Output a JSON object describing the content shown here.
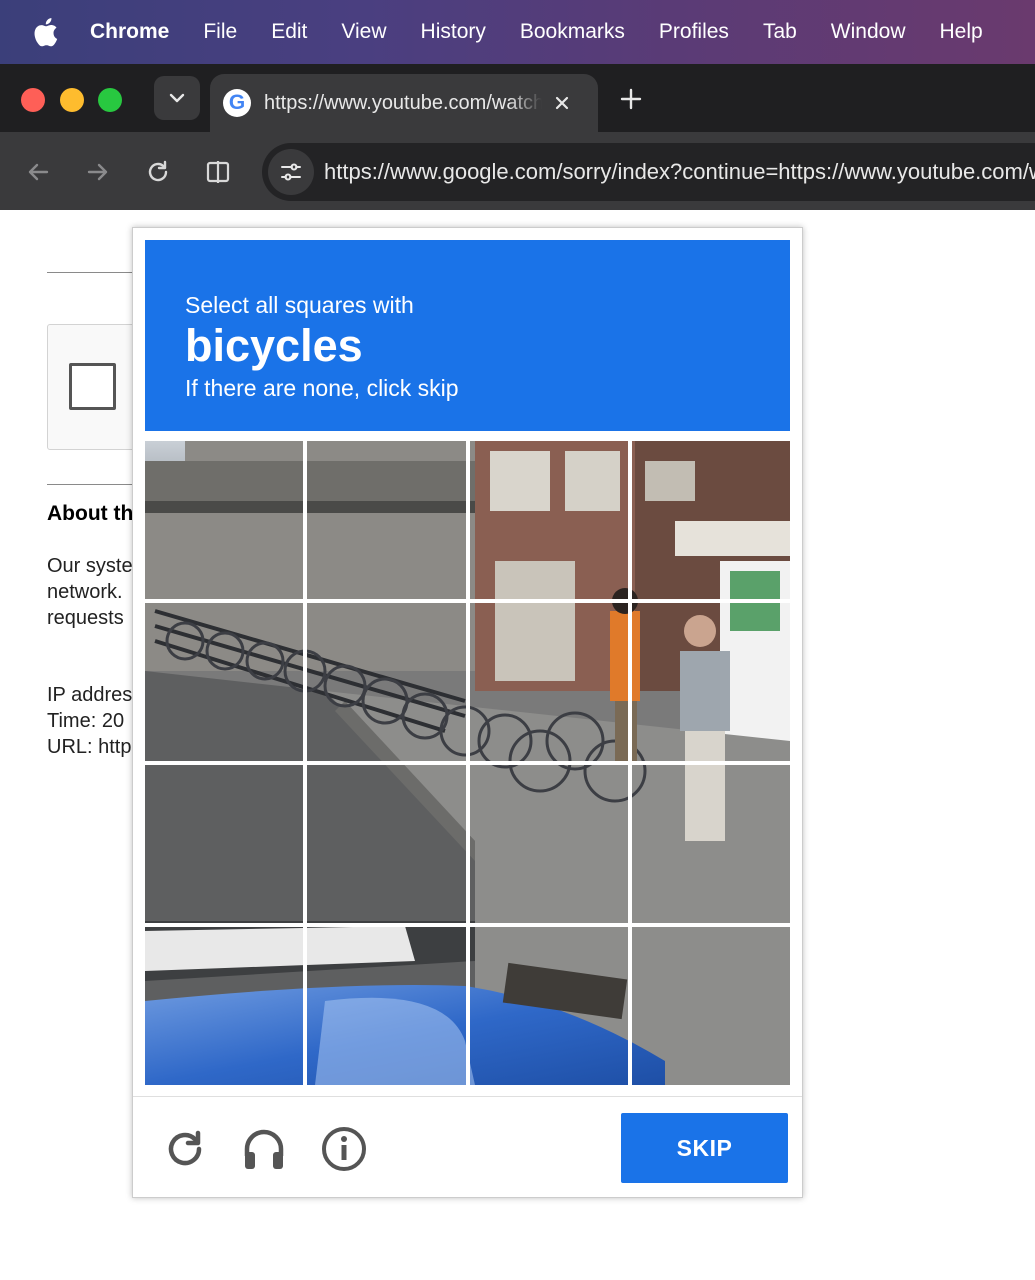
{
  "menubar": {
    "app_name": "Chrome",
    "items": [
      "File",
      "Edit",
      "View",
      "History",
      "Bookmarks",
      "Profiles",
      "Tab",
      "Window",
      "Help"
    ]
  },
  "tab": {
    "favicon_letter": "G",
    "title": "https://www.youtube.com/watch"
  },
  "toolbar": {
    "url": "https://www.google.com/sorry/index?continue=https://www.youtube.com/watch"
  },
  "page": {
    "about_heading": "About th",
    "body_lines": [
      "Our syste",
      "network.",
      "requests"
    ],
    "info_lines": [
      "IP addres",
      "Time: 20",
      "URL: http"
    ]
  },
  "captcha": {
    "instruction": "Select all squares with",
    "keyword": "bicycles",
    "hint": "If there are none, click skip",
    "skip_label": "SKIP",
    "accent_color": "#1a73e8",
    "footer_icons": [
      "reload-icon",
      "headphones-icon",
      "info-icon"
    ]
  }
}
